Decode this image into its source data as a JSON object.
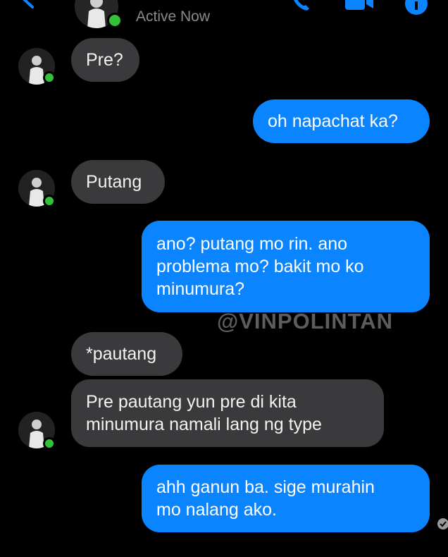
{
  "header": {
    "status": "Active Now",
    "icons": [
      "back-arrow-icon",
      "phone-icon",
      "video-icon",
      "info-icon"
    ]
  },
  "messages": [
    {
      "from": "contact",
      "text": "Pre?"
    },
    {
      "from": "me",
      "text": "oh napachat ka?"
    },
    {
      "from": "contact",
      "text": "Putang"
    },
    {
      "from": "me",
      "lines": [
        "ano? putang mo rin. ano",
        "problema mo? bakit mo ko",
        "minumura?"
      ]
    },
    {
      "from": "contact",
      "text": "*pautang"
    },
    {
      "from": "contact",
      "lines": [
        "Pre pautang yun pre di kita",
        "minumura namali lang ng type"
      ]
    },
    {
      "from": "me",
      "lines": [
        "ahh ganun ba. sige murahin",
        "mo nalang ako."
      ]
    }
  ],
  "watermark": "@VINPOLINTAN",
  "colors": {
    "background": "#000000",
    "incoming_bubble": "#3a3a3c",
    "outgoing_bubble": "#0a84ff",
    "online": "#33c13a",
    "accent": "#0a84ff"
  }
}
